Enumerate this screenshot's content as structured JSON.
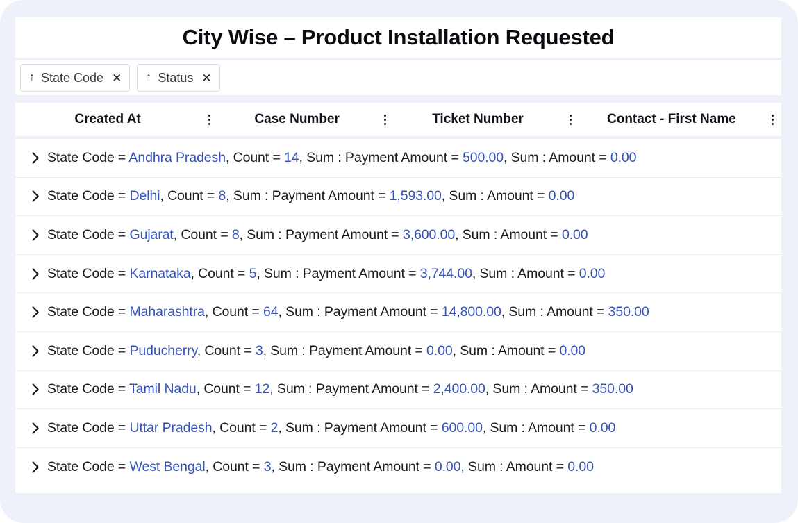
{
  "theme": {
    "page_background": "#eef1f9",
    "panel_background": "#ffffff",
    "value_accent": "#3552b8",
    "text_primary": "#1a1c22",
    "row_divider": "#ececee"
  },
  "header": {
    "title": "City Wise – Product Installation Requested"
  },
  "group_chips": {
    "arrow_icon": "sort-ascending-arrow-icon",
    "close_icon": "close-icon",
    "items": [
      {
        "label": "State Code"
      },
      {
        "label": "Status"
      }
    ]
  },
  "columns": {
    "menu_icon": "kebab-menu-icon",
    "items": [
      {
        "label": "Created At"
      },
      {
        "label": "Case Number"
      },
      {
        "label": "Ticket Number"
      },
      {
        "label": "Contact - First Name"
      }
    ]
  },
  "grid": {
    "expand_icon": "chevron-right-icon",
    "labels": {
      "group_field": "State Code",
      "count": "Count",
      "sum_payment_amount": "Sum : Payment Amount",
      "sum_amount": "Sum : Amount",
      "equals": "=",
      "separator": ", "
    },
    "rows": [
      {
        "state_code": "Andhra Pradesh",
        "count": "14",
        "sum_payment_amount": "500.00",
        "sum_amount": "0.00"
      },
      {
        "state_code": "Delhi",
        "count": "8",
        "sum_payment_amount": "1,593.00",
        "sum_amount": "0.00"
      },
      {
        "state_code": "Gujarat",
        "count": "8",
        "sum_payment_amount": "3,600.00",
        "sum_amount": "0.00"
      },
      {
        "state_code": "Karnataka",
        "count": "5",
        "sum_payment_amount": "3,744.00",
        "sum_amount": "0.00"
      },
      {
        "state_code": "Maharashtra",
        "count": "64",
        "sum_payment_amount": "14,800.00",
        "sum_amount": "350.00"
      },
      {
        "state_code": "Puducherry",
        "count": "3",
        "sum_payment_amount": "0.00",
        "sum_amount": "0.00"
      },
      {
        "state_code": "Tamil Nadu",
        "count": "12",
        "sum_payment_amount": "2,400.00",
        "sum_amount": "350.00"
      },
      {
        "state_code": "Uttar Pradesh",
        "count": "2",
        "sum_payment_amount": "600.00",
        "sum_amount": "0.00"
      },
      {
        "state_code": "West Bengal",
        "count": "3",
        "sum_payment_amount": "0.00",
        "sum_amount": "0.00"
      }
    ]
  }
}
